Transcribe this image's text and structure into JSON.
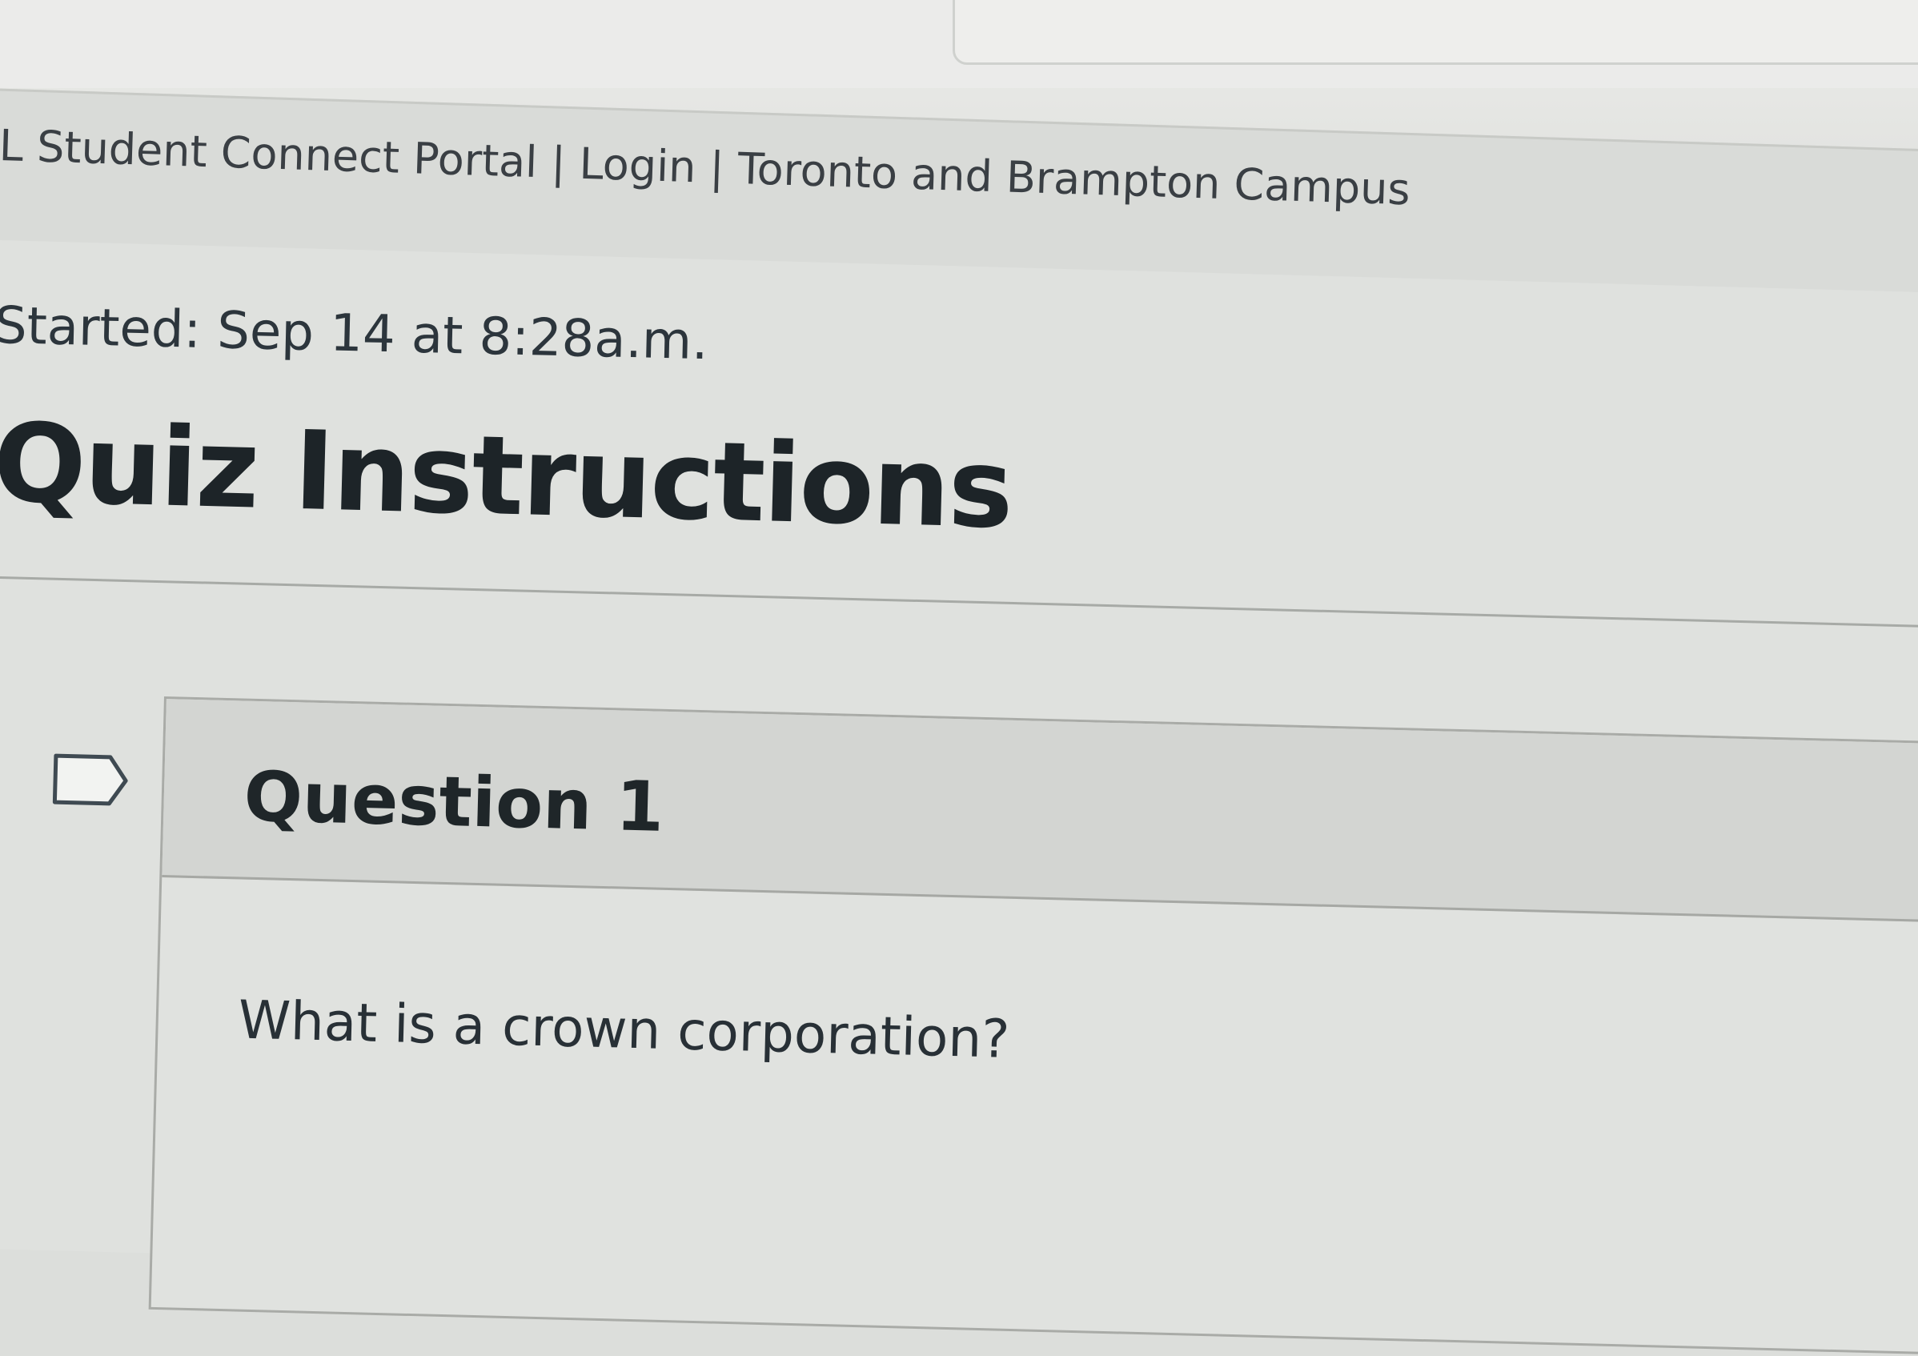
{
  "browser": {
    "tab_title": "L Student Connect Portal | Login | Toronto and Brampton Campus"
  },
  "quiz": {
    "started": "Started: Sep 14 at 8:28a.m.",
    "title": "Quiz Instructions"
  },
  "question": {
    "label": "Question 1",
    "text": "What is a crown corporation?",
    "flag_icon": "flag-icon"
  },
  "colors": {
    "background": "#dfe1de",
    "header_band": "#d3d5d2",
    "text_dark": "#1f2629"
  }
}
